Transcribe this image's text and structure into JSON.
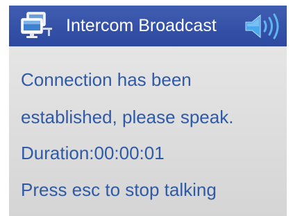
{
  "header": {
    "title": "Intercom Broadcast",
    "left_icon": "computer-network-icon",
    "right_icon": "speaker-volume-icon",
    "background_color": "#2f4ca3"
  },
  "message": {
    "connection_line1": "Connection has been",
    "connection_line2": "established, please speak.",
    "duration": "Duration:00:00:01",
    "instruction": "Press esc to stop talking",
    "text_color": "#2f5aa6"
  }
}
